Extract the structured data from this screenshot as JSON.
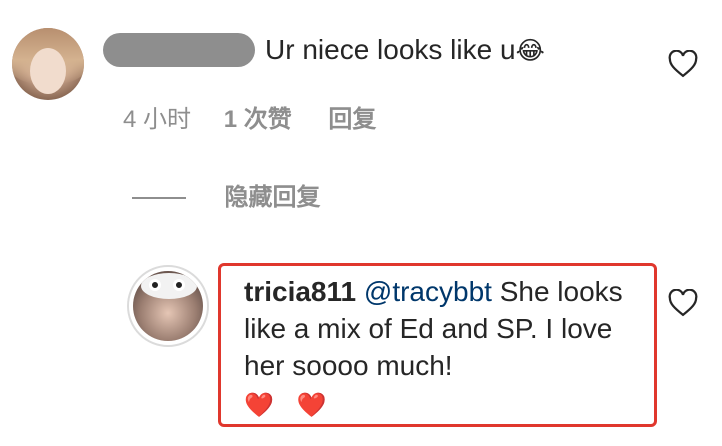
{
  "comment": {
    "text": "Ur niece looks like u",
    "emoji": "😂",
    "time": "4 小时",
    "likes": "1 次赞",
    "reply_label": "回复"
  },
  "replies_toggle": {
    "label": "隐藏回复"
  },
  "reply": {
    "username": "tricia811",
    "mention": "@tracybbt",
    "text": " She looks like a mix of Ed and SP. I love her soooo much!",
    "emojis": "❤️ ❤️"
  },
  "colors": {
    "text": "#262626",
    "secondary": "#8e8e8e",
    "mention": "#00376b",
    "highlight": "#e0372d"
  },
  "icons": [
    "heart-outline-icon",
    "heart-outline-icon"
  ]
}
